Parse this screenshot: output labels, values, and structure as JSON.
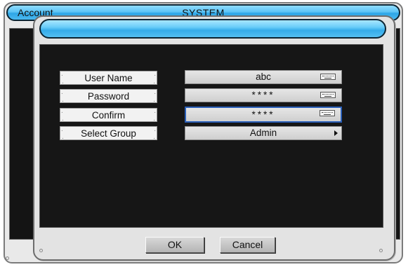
{
  "background_window": {
    "title_left": "Account",
    "title_center": "SYSTEM"
  },
  "dialog": {
    "title": "",
    "fields": [
      {
        "label": "User Name",
        "value": "abc",
        "control": "keyboard-icon",
        "active": false
      },
      {
        "label": "Password",
        "value": "****",
        "control": "keyboard-icon",
        "active": false
      },
      {
        "label": "Confirm",
        "value": "****",
        "control": "keyboard-icon",
        "active": true
      },
      {
        "label": "Select Group",
        "value": "Admin",
        "control": "arrow-right-icon",
        "active": false
      }
    ],
    "buttons": {
      "ok": "OK",
      "cancel": "Cancel"
    }
  },
  "colors": {
    "titlebar": "#35acea",
    "body": "#161616",
    "active_border": "#2a5fb8"
  }
}
